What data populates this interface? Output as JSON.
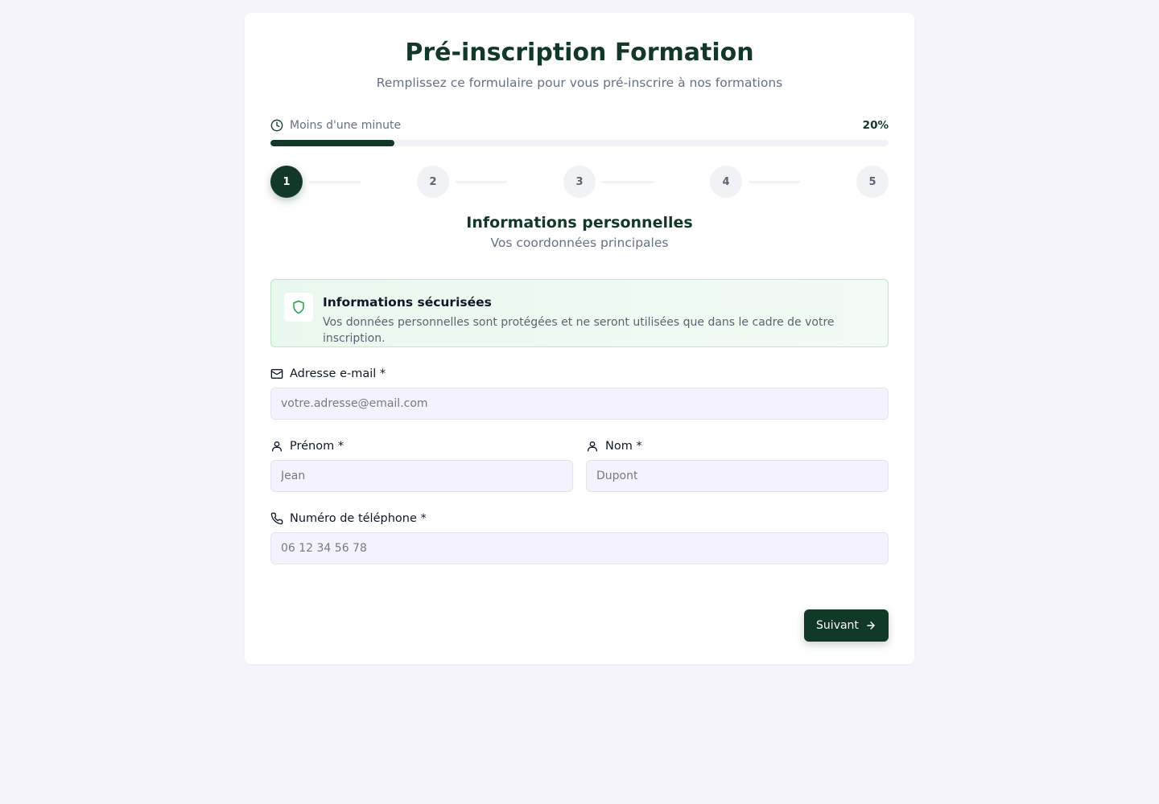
{
  "header": {
    "title": "Pré-inscription Formation",
    "subtitle": "Remplissez ce formulaire pour vous pré-inscrire à nos formations"
  },
  "progress": {
    "time_label": "Moins d'une minute",
    "percent_label": "20%",
    "value": 0.2
  },
  "steps": [
    "1",
    "2",
    "3",
    "4",
    "5"
  ],
  "current_step": 1,
  "section": {
    "title": "Informations personnelles",
    "subtitle": "Vos coordonnées principales"
  },
  "secure_notice": {
    "title": "Informations sécurisées",
    "text": "Vos données personnelles sont protégées et ne seront utilisées que dans le cadre de votre inscription.",
    "icon": "shield-icon"
  },
  "fields": {
    "email": {
      "label": "Adresse e-mail *",
      "placeholder": "votre.adresse@email.com",
      "value": "",
      "icon": "mail-icon"
    },
    "first_name": {
      "label": "Prénom *",
      "placeholder": "Jean",
      "value": "",
      "icon": "user-icon"
    },
    "last_name": {
      "label": "Nom *",
      "placeholder": "Dupont",
      "value": "",
      "icon": "user-icon"
    },
    "phone": {
      "label": "Numéro de téléphone *",
      "placeholder": "06 12 34 56 78",
      "value": "",
      "icon": "phone-icon"
    }
  },
  "actions": {
    "next_label": "Suivant"
  },
  "colors": {
    "primary": "#123828",
    "background": "#f5f4fd",
    "input_background": "#f4f3fd",
    "secure_border": "#bfe6c9",
    "secure_icon": "#22a04b"
  }
}
